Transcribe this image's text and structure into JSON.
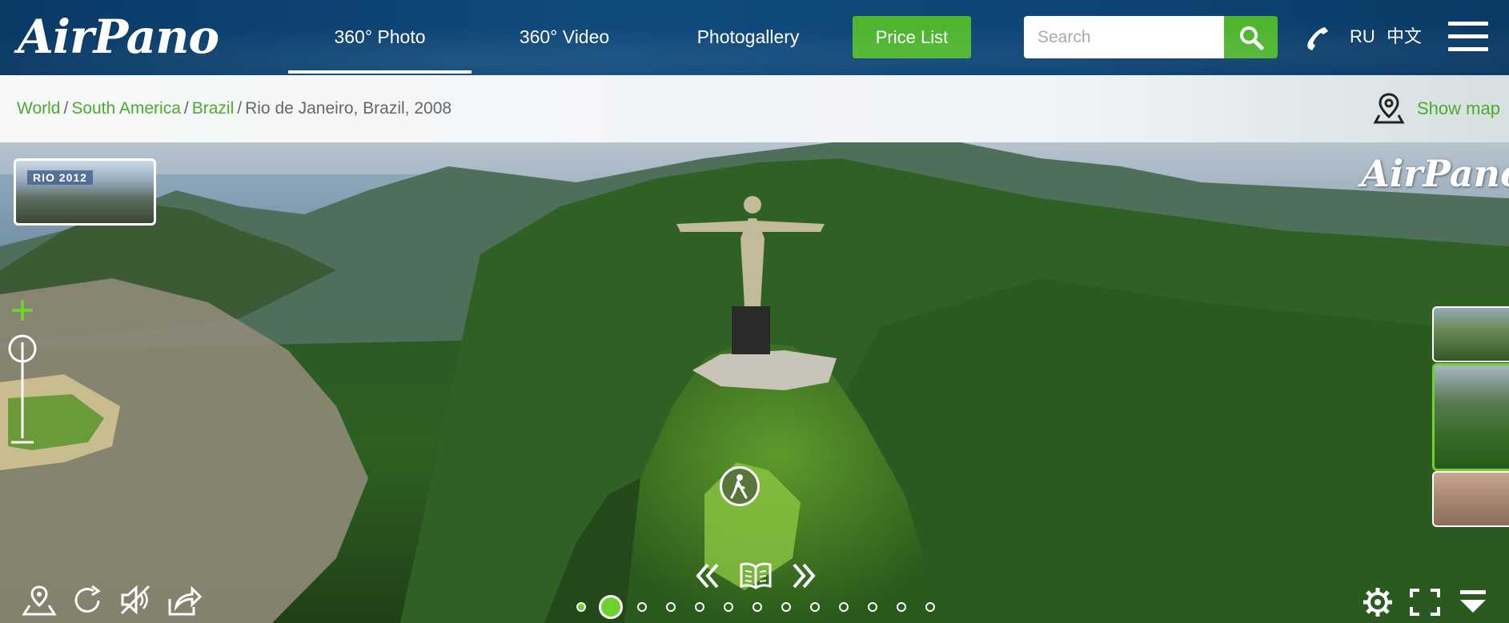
{
  "header": {
    "logo": "AirPano",
    "nav": [
      {
        "label": "360° Photo",
        "active": true
      },
      {
        "label": "360° Video",
        "active": false
      },
      {
        "label": "Photogallery",
        "active": false
      }
    ],
    "price_list": "Price List",
    "search_placeholder": "Search",
    "languages": [
      "RU",
      "中文"
    ]
  },
  "breadcrumb": {
    "items": [
      "World",
      "South America",
      "Brazil"
    ],
    "current": "Rio de Janeiro, Brazil, 2008",
    "show_map": "Show map"
  },
  "panorama": {
    "watermark": "AirPano",
    "featured_thumb_label": "RIO 2012",
    "pagination": {
      "count": 13,
      "active_index": 1
    },
    "accent_color": "#6fd12b"
  },
  "icons": [
    "search-icon",
    "phone-icon",
    "menu-icon",
    "map-pin-icon",
    "zoom-in-icon",
    "zoom-out-icon",
    "location-icon",
    "rotate-icon",
    "sound-off-icon",
    "share-icon",
    "prev-icon",
    "book-icon",
    "next-icon",
    "settings-icon",
    "fullscreen-icon",
    "collapse-icon",
    "walk-hotspot-icon"
  ]
}
